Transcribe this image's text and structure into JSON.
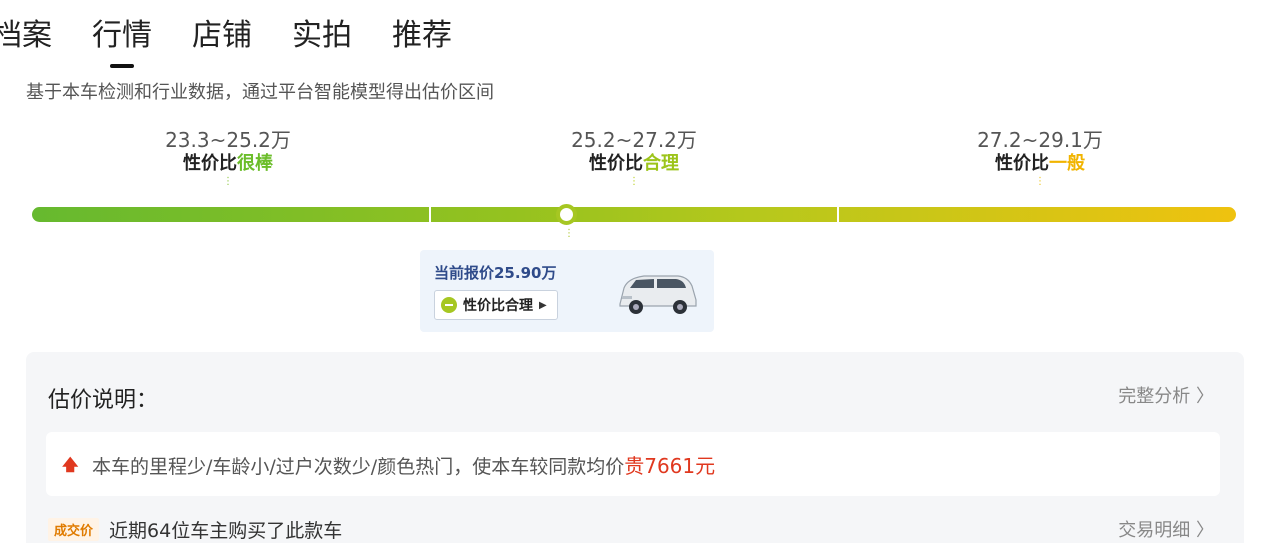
{
  "tabs": [
    "档案",
    "行情",
    "店铺",
    "实拍",
    "推荐"
  ],
  "active_tab": "行情",
  "intro": "基于本车检测和行业数据，通过平台智能模型得出估价区间",
  "ranges": [
    {
      "value": "23.3~25.2万",
      "prefix": "性价比",
      "level": "很棒",
      "color": "#6bbd2a"
    },
    {
      "value": "25.2~27.2万",
      "prefix": "性价比",
      "level": "合理",
      "color": "#9cc41a"
    },
    {
      "value": "27.2~29.1万",
      "prefix": "性价比",
      "level": "一般",
      "color": "#f1b400"
    }
  ],
  "current": {
    "label": "当前报价25.90万",
    "chip": "性价比合理",
    "chip_icon": "smile-icon"
  },
  "explanation": {
    "title": "估价说明：",
    "more": "完整分析 〉",
    "reason_prefix": "本车的里程少/车龄小/过户次数少/颜色热门，使本车较同款均价",
    "reason_highlight": "贵7661元",
    "deal_badge": "成交价",
    "deal_text": "近期64位车主购买了此款车",
    "deal_more": "交易明细 〉"
  },
  "colors": {
    "accent_red": "#e0381f",
    "bar_start": "#66b92f",
    "bar_end": "#efc20f"
  }
}
